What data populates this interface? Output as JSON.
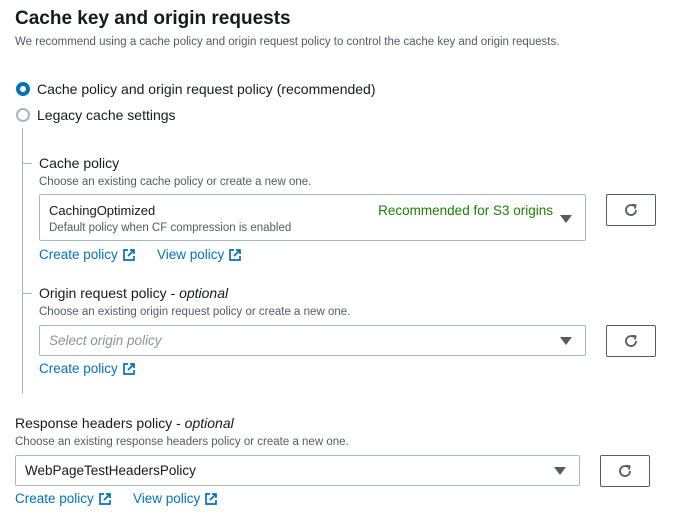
{
  "section": {
    "title": "Cache key and origin requests",
    "description": "We recommend using a cache policy and origin request policy to control the cache key and origin requests."
  },
  "radios": {
    "option1": "Cache policy and origin request policy (recommended)",
    "option2": "Legacy cache settings",
    "selected": "option1"
  },
  "cache_policy": {
    "label": "Cache policy",
    "description": "Choose an existing cache policy or create a new one.",
    "selected_value": "CachingOptimized",
    "selected_subtext": "Default policy when CF compression is enabled",
    "recommendation": "Recommended for S3 origins",
    "create_link": "Create policy",
    "view_link": "View policy"
  },
  "origin_request_policy": {
    "label": "Origin request policy",
    "label_suffix": "optional",
    "description": "Choose an existing origin request policy or create a new one.",
    "placeholder": "Select origin policy",
    "create_link": "Create policy"
  },
  "response_headers_policy": {
    "label": "Response headers policy",
    "label_suffix": "optional",
    "description": "Choose an existing response headers policy or create a new one.",
    "selected_value": "WebPageTestHeadersPolicy",
    "create_link": "Create policy",
    "view_link": "View policy"
  },
  "colors": {
    "accent": "#0073bb",
    "recommended": "#1d8102",
    "border": "#aab7b8",
    "secondary_text": "#545b64"
  }
}
